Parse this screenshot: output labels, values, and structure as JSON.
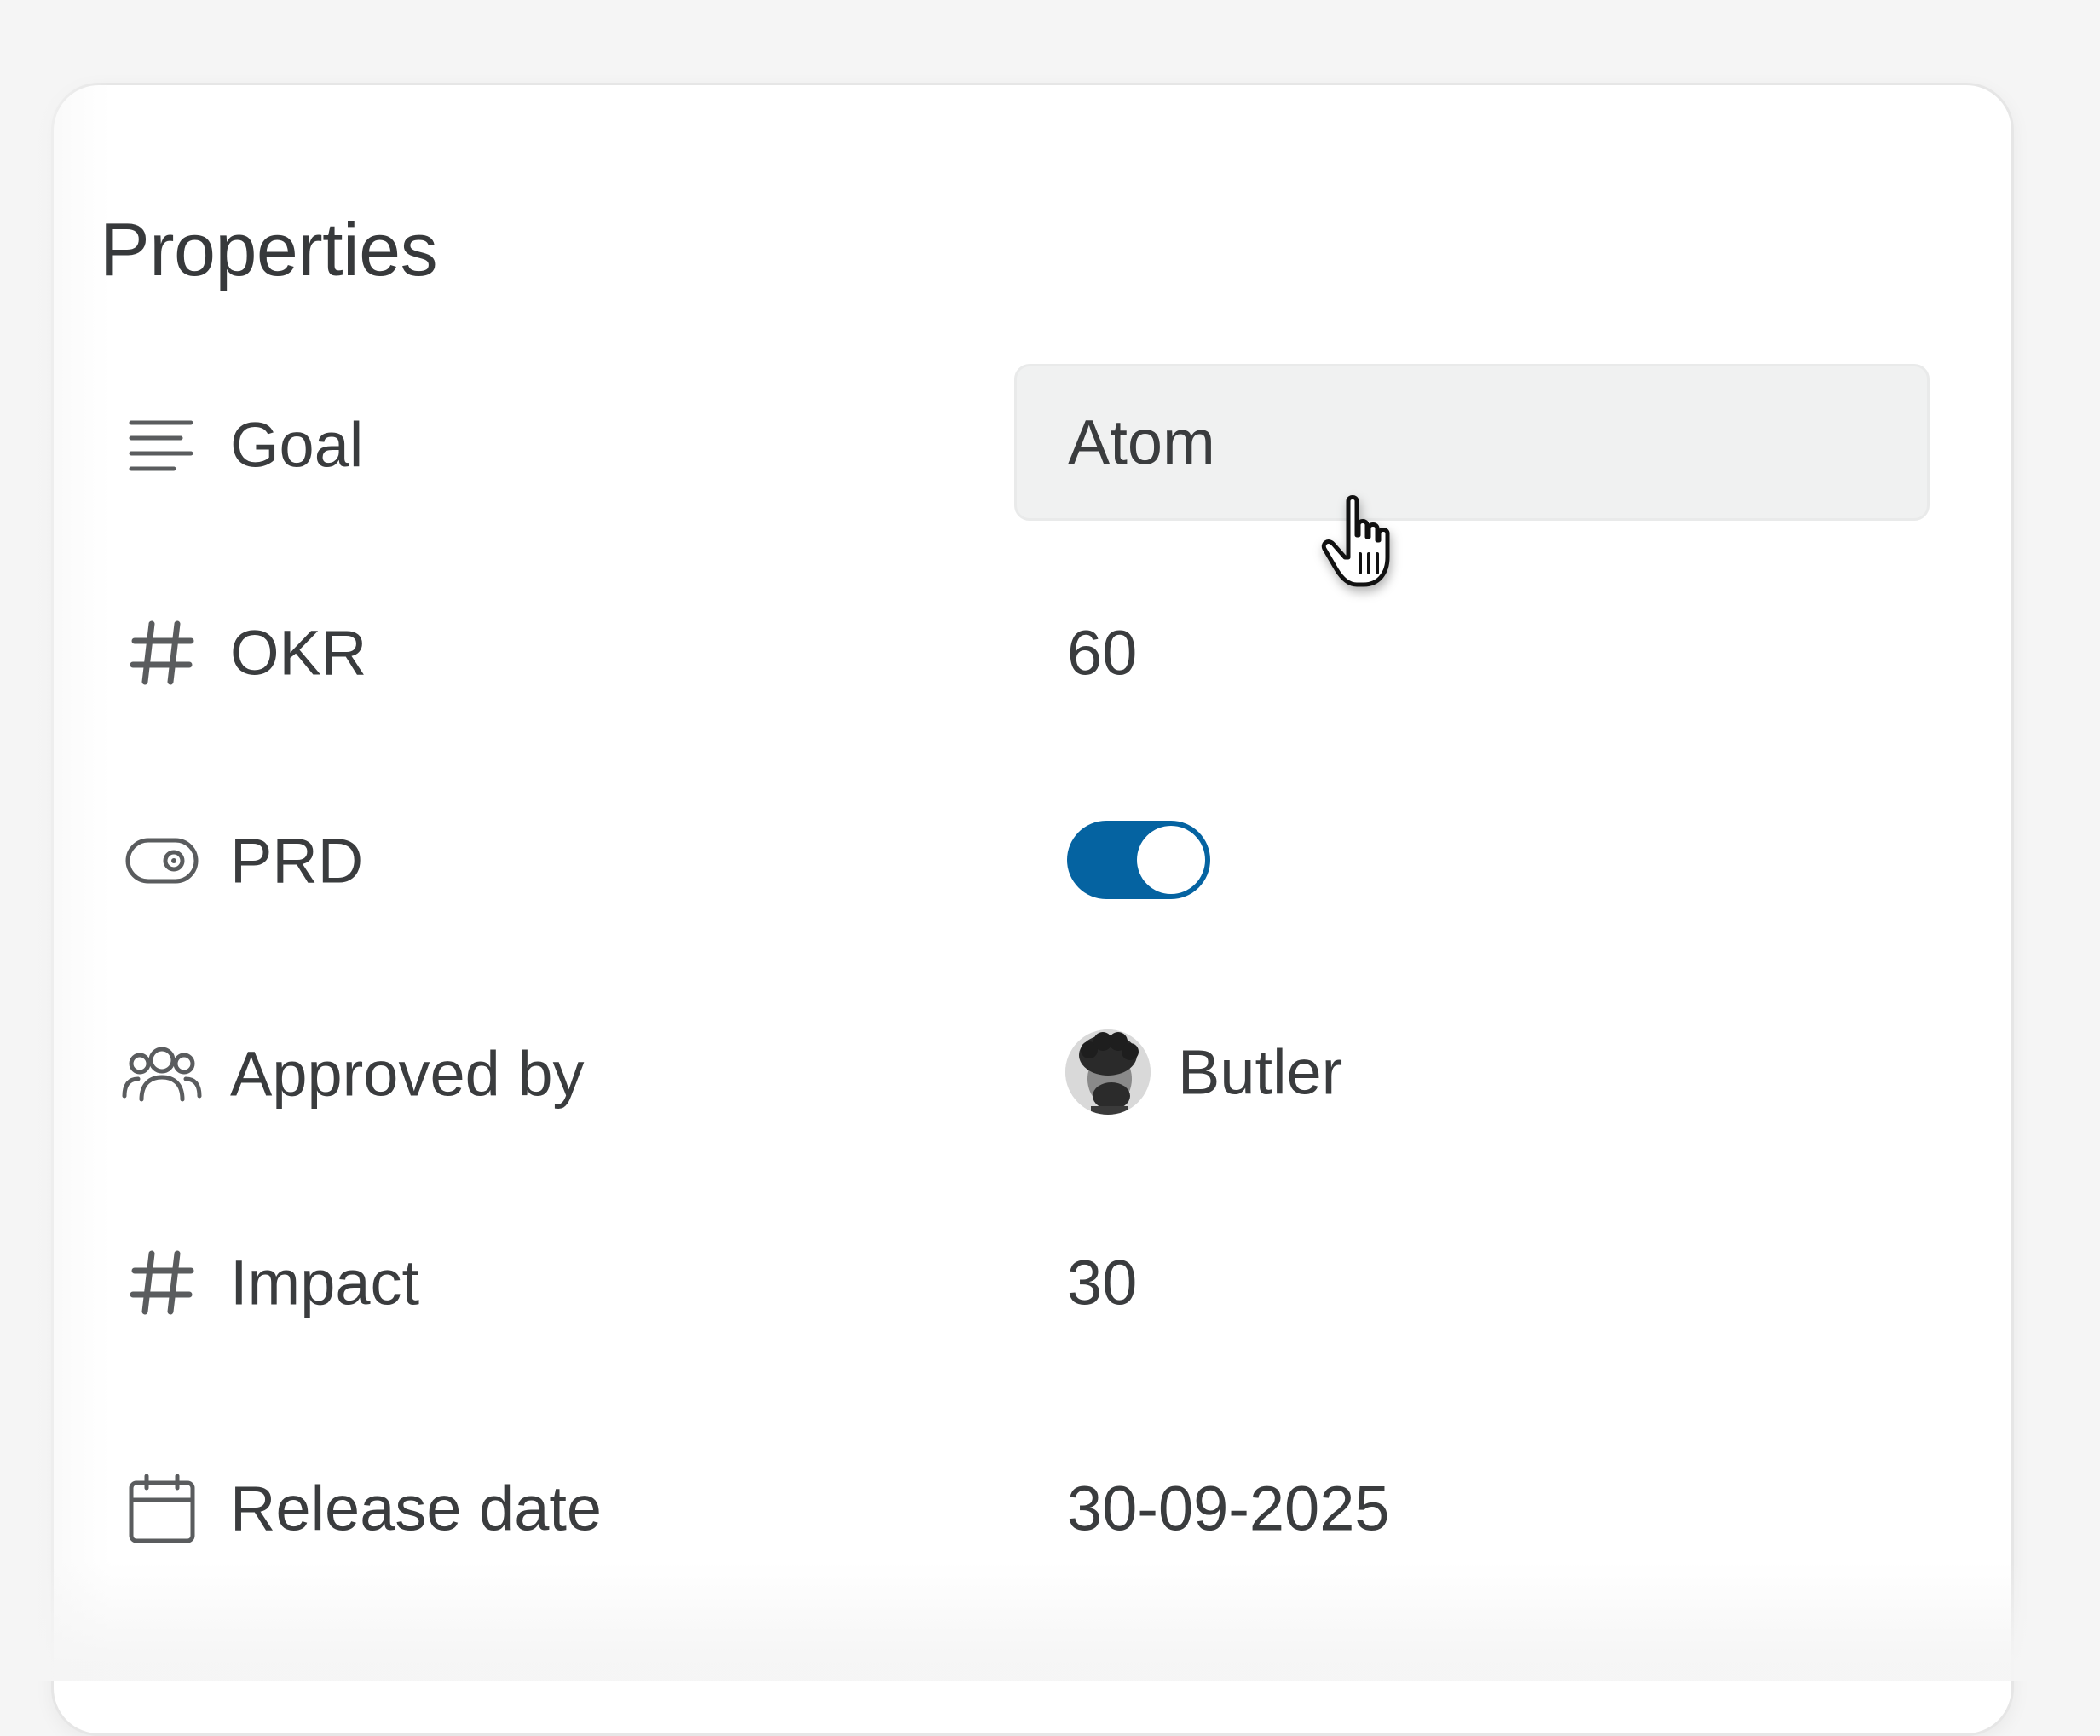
{
  "panel": {
    "title": "Properties"
  },
  "properties": [
    {
      "label": "Goal",
      "icon": "text-lines-icon",
      "value": "Atom"
    },
    {
      "label": "OKR",
      "icon": "hash-icon",
      "value": "60"
    },
    {
      "label": "PRD",
      "icon": "toggle-icon",
      "value_type": "toggle",
      "toggle_on": true
    },
    {
      "label": "Approved by",
      "icon": "people-icon",
      "value": "Butler",
      "avatar": "avatar-photo"
    },
    {
      "label": "Impact",
      "icon": "hash-icon",
      "value": "30"
    },
    {
      "label": "Release date",
      "icon": "calendar-icon",
      "value": "30-09-2025"
    }
  ],
  "colors": {
    "toggle_on": "#0563a1",
    "text": "#3a3c3e",
    "field_bg": "#f0f1f1"
  },
  "cursor": "hand-pointer-icon"
}
